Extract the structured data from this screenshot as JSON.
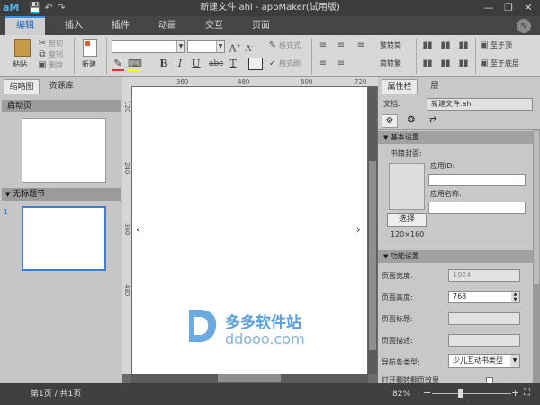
{
  "titlebar": {
    "logo": "aM",
    "title": "新建文件 ahl - appMaker(试用版)",
    "undo_icon": "undo-icon",
    "redo_icon": "redo-icon"
  },
  "tabs": [
    "编辑",
    "插入",
    "插件",
    "动画",
    "交互",
    "页面"
  ],
  "ribbon": {
    "paste": "粘贴",
    "cut": "剪切",
    "copy": "复制",
    "delete": "删除",
    "new": "新建",
    "format_brush": "格式式",
    "format_brush2": "格式刷",
    "simp_trad": "繁转简",
    "trad_simp": "简转繁",
    "bring_top": "至于顶",
    "send_bottom": "至于底层"
  },
  "left_panel": {
    "tabs": [
      "缩略图",
      "资源库"
    ],
    "start_page": "启动页",
    "untitled_section": "无标题节",
    "page_number": "1"
  },
  "rulers": {
    "h": [
      "360",
      "480",
      "600",
      "720"
    ],
    "v": [
      "120",
      "240",
      "360",
      "480"
    ]
  },
  "right_panel": {
    "tabs": [
      "属性栏",
      "层"
    ],
    "file_label": "文档:",
    "file_value": "新建文件.ahl",
    "basic_section": "基本设置",
    "cover_label": "书籍封面:",
    "app_id_label": "应用ID:",
    "app_name_label": "应用名称:",
    "select_button": "选择",
    "cover_size": "120×160",
    "func_section": "功能设置",
    "page_width_label": "页面宽度:",
    "page_width": "1024",
    "page_height_label": "页面高度:",
    "page_height": "768",
    "page_title_label": "页面标题:",
    "page_desc_label": "页面描述:",
    "navbar_label": "导航条类型:",
    "navbar_value": "少儿互动书类型",
    "cut_off": "打开翻转翻页效果"
  },
  "statusbar": {
    "page_text": "第1页 / 共1页",
    "zoom": "82%"
  },
  "watermark": {
    "brand": "多多软件站",
    "url": "ddooo.com"
  }
}
